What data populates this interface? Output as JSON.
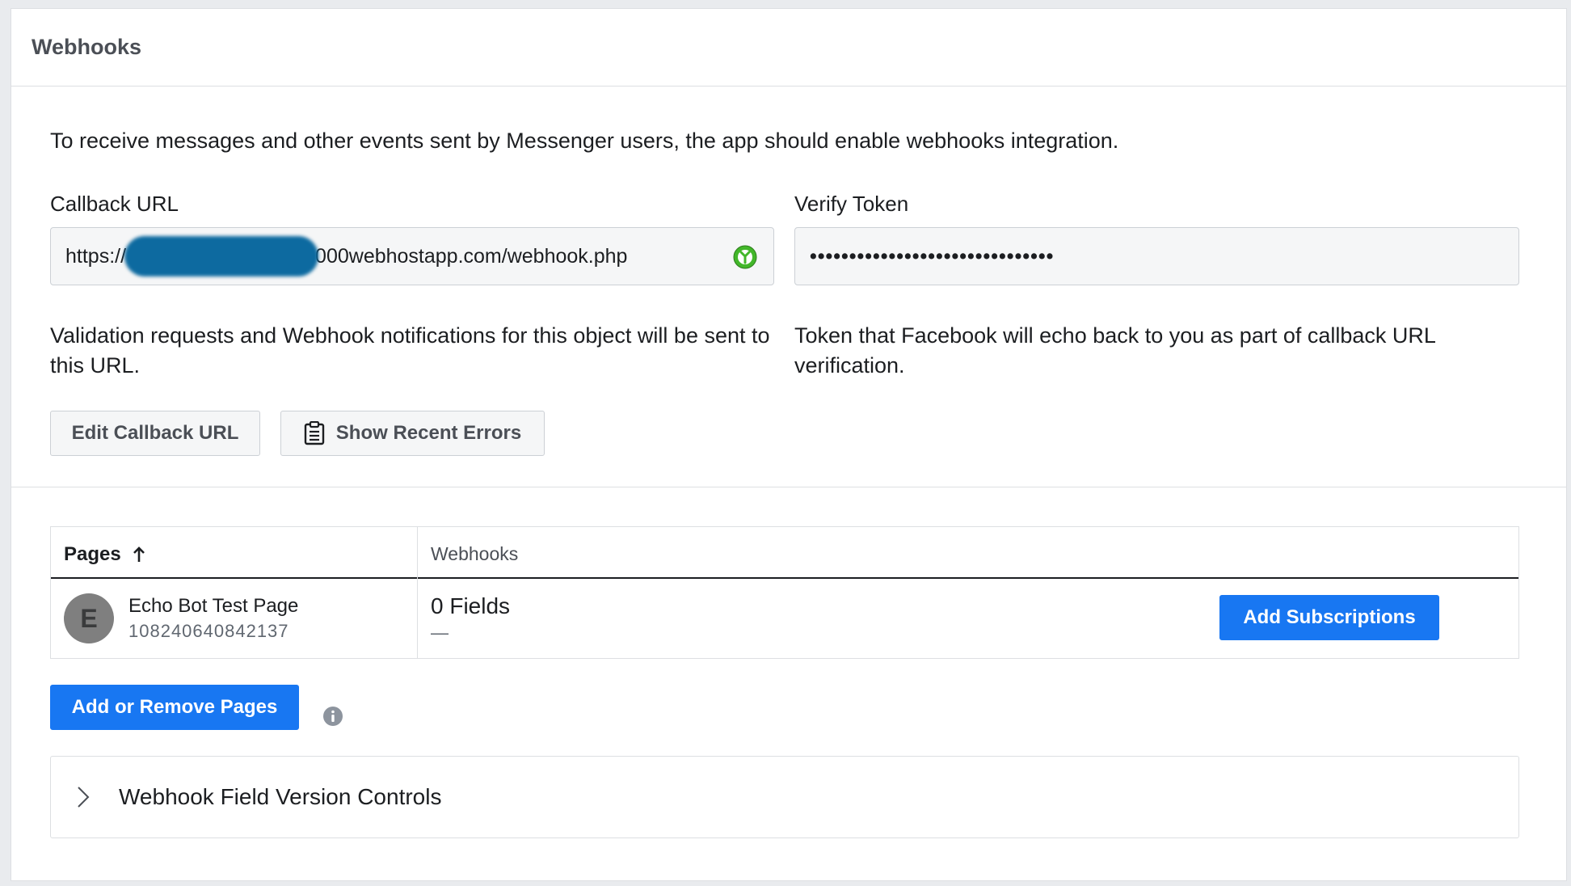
{
  "panel": {
    "title": "Webhooks"
  },
  "intro_text": "To receive messages and other events sent by Messenger users, the app should enable webhooks integration.",
  "callback": {
    "label": "Callback URL",
    "value_prefix": "https://",
    "value_suffix": "000webhostapp.com/webhook.php",
    "help": "Validation requests and Webhook notifications for this object will be sent to this URL."
  },
  "verify_token": {
    "label": "Verify Token",
    "value": "•••••••••••••••••••••••••••••••",
    "help": "Token that Facebook will echo back to you as part of callback URL verification."
  },
  "buttons": {
    "edit_callback": "Edit Callback URL",
    "show_errors": "Show Recent Errors",
    "add_subscriptions": "Add Subscriptions",
    "add_remove_pages": "Add or Remove Pages"
  },
  "table": {
    "col_pages": "Pages",
    "col_webhooks": "Webhooks",
    "rows": [
      {
        "avatar_letter": "E",
        "name": "Echo Bot Test Page",
        "id": "108240640842137",
        "fields": "0 Fields",
        "fields_detail": "—"
      }
    ]
  },
  "accordion": {
    "label": "Webhook Field Version Controls"
  },
  "colors": {
    "primary": "#1877f2",
    "success": "#42b72a"
  }
}
